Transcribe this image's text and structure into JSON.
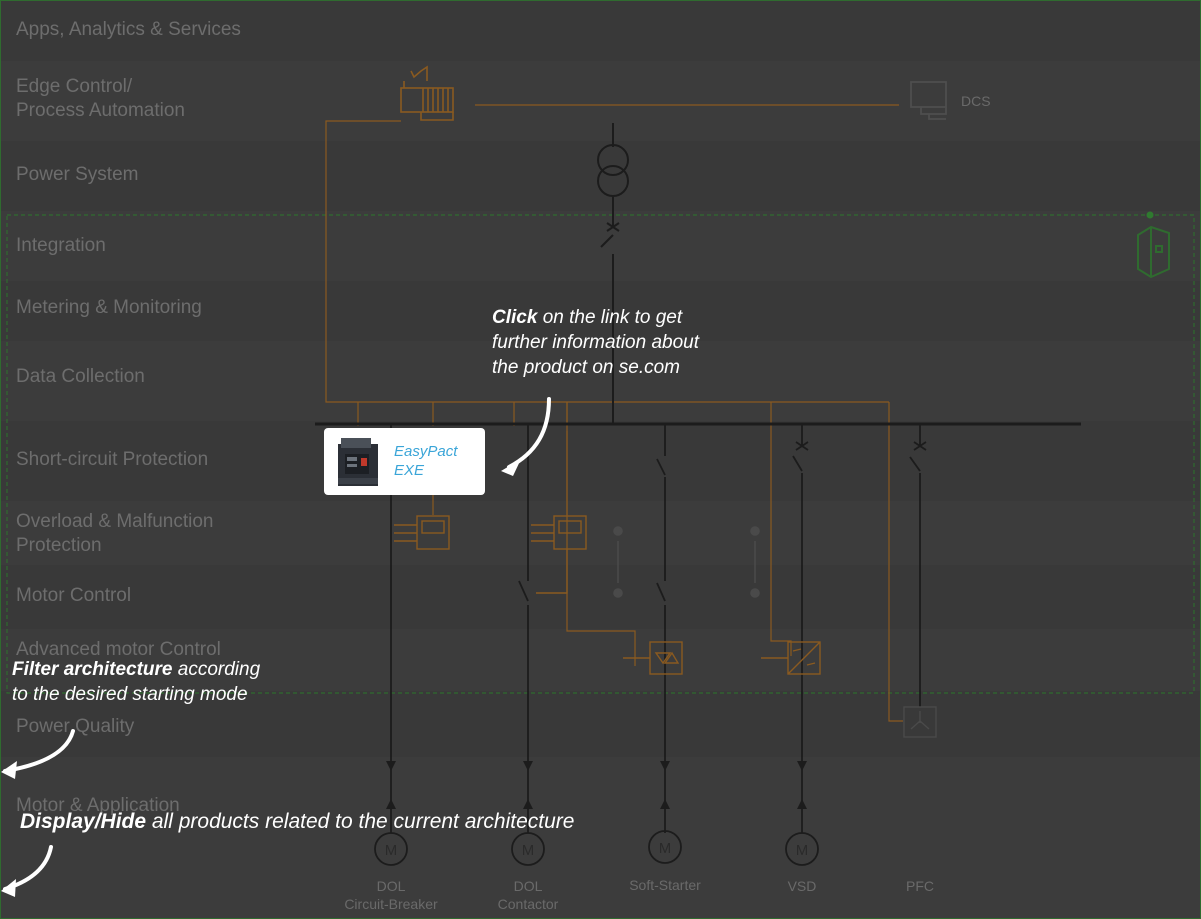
{
  "bands": [
    {
      "label": "Apps, Analytics & Services"
    },
    {
      "label": "Edge Control/\nProcess Automation"
    },
    {
      "label": "Power System"
    },
    {
      "label": "Integration"
    },
    {
      "label": "Metering & Monitoring"
    },
    {
      "label": "Data Collection"
    },
    {
      "label": "Short-circuit Protection"
    },
    {
      "label": "Overload & Malfunction\nProtection"
    },
    {
      "label": "Motor Control"
    },
    {
      "label": "Advanced motor Control"
    },
    {
      "label": "Power Quality"
    },
    {
      "label": "Motor & Application"
    }
  ],
  "diagram": {
    "dcs_label": "DCS",
    "motor_symbol": "M",
    "feeders": [
      {
        "label": "DOL\nCircuit-Breaker"
      },
      {
        "label": "DOL\nContactor"
      },
      {
        "label": "Soft-Starter"
      },
      {
        "label": "VSD"
      },
      {
        "label": "PFC"
      }
    ]
  },
  "product_card": {
    "name": "EasyPact\nEXE",
    "image_icon": "circuit-breaker-product-image"
  },
  "annotations": {
    "click_bold": "Click",
    "click_rest": " on the link to get\nfurther information about\nthe product on se.com",
    "filter_bold": "Filter architecture",
    "filter_rest": " according\nto the desired starting mode",
    "display_bold": "Display/Hide",
    "display_rest": " all products related to the current architecture"
  },
  "colors": {
    "background": "#383838",
    "band_alt": "#3d3d3d",
    "line": "#1a1a1a",
    "orange": "#8a5a20",
    "green_dash": "#2f6b2f",
    "link_text": "#3aa5d8"
  }
}
